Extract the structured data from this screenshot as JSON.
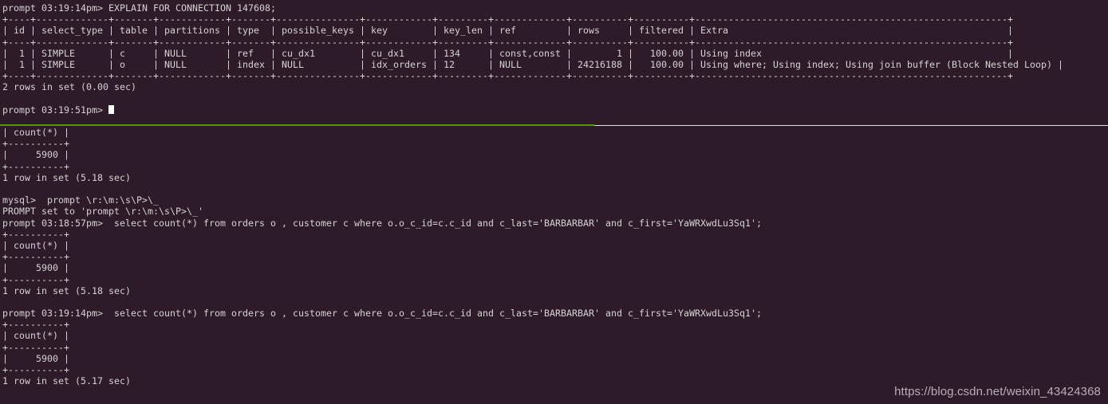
{
  "terminal": {
    "title": "MySQL client session",
    "colors": {
      "background": "#2d1b2a",
      "foreground": "#d8d2d4",
      "cursor": "#ffffff",
      "rule_left": "#4e9a06",
      "rule_right": "#e6e2e4",
      "watermark": "#b9aeb5"
    },
    "prompt_template": "prompt \\r:\\m:\\s\\P>\\_",
    "lines": [
      {
        "id": "l01",
        "text": "prompt 03:19:14pm> EXPLAIN FOR CONNECTION 147608;"
      },
      {
        "id": "l02",
        "text": "+----+-------------+-------+------------+-------+---------------+------------+---------+-------------+----------+----------+--------------------------------------------------------+"
      },
      {
        "id": "l03",
        "text": "| id | select_type | table | partitions | type  | possible_keys | key        | key_len | ref         | rows     | filtered | Extra                                                  |"
      },
      {
        "id": "l04",
        "text": "+----+-------------+-------+------------+-------+---------------+------------+---------+-------------+----------+----------+--------------------------------------------------------+"
      },
      {
        "id": "l05",
        "text": "|  1 | SIMPLE      | c     | NULL       | ref   | cu_dx1        | cu_dx1     | 134     | const,const |        1 |   100.00 | Using index                                            |"
      },
      {
        "id": "l06",
        "text": "|  1 | SIMPLE      | o     | NULL       | index | NULL          | idx_orders | 12      | NULL        | 24216188 |   100.00 | Using where; Using index; Using join buffer (Block Nested Loop) |"
      },
      {
        "id": "l07",
        "text": "+----+-------------+-------+------------+-------+---------------+------------+---------+-------------+----------+----------+--------------------------------------------------------+"
      },
      {
        "id": "l08",
        "text": "2 rows in set (0.00 sec)"
      },
      {
        "id": "l09",
        "text": ""
      },
      {
        "id": "l10",
        "text": "prompt 03:19:51pm> ",
        "cursor": true
      },
      {
        "id": "l11",
        "text": ""
      },
      {
        "id": "l12",
        "text": "| count(*) |"
      },
      {
        "id": "l13",
        "text": "+----------+"
      },
      {
        "id": "l14",
        "text": "|     5900 |"
      },
      {
        "id": "l15",
        "text": "+----------+"
      },
      {
        "id": "l16",
        "text": "1 row in set (5.18 sec)"
      },
      {
        "id": "l17",
        "text": ""
      },
      {
        "id": "l18",
        "text": "mysql>  prompt \\r:\\m:\\s\\P>\\_"
      },
      {
        "id": "l19",
        "text": "PROMPT set to 'prompt \\r:\\m:\\s\\P>\\_'"
      },
      {
        "id": "l20",
        "text": "prompt 03:18:57pm>  select count(*) from orders o , customer c where o.o_c_id=c.c_id and c_last='BARBARBAR' and c_first='YaWRXwdLu3Sq1';"
      },
      {
        "id": "l21",
        "text": "+----------+"
      },
      {
        "id": "l22",
        "text": "| count(*) |"
      },
      {
        "id": "l23",
        "text": "+----------+"
      },
      {
        "id": "l24",
        "text": "|     5900 |"
      },
      {
        "id": "l25",
        "text": "+----------+"
      },
      {
        "id": "l26",
        "text": "1 row in set (5.18 sec)"
      },
      {
        "id": "l27",
        "text": ""
      },
      {
        "id": "l28",
        "text": "prompt 03:19:14pm>  select count(*) from orders o , customer c where o.o_c_id=c.c_id and c_last='BARBARBAR' and c_first='YaWRXwdLu3Sq1';"
      },
      {
        "id": "l29",
        "text": "+----------+"
      },
      {
        "id": "l30",
        "text": "| count(*) |"
      },
      {
        "id": "l31",
        "text": "+----------+"
      },
      {
        "id": "l32",
        "text": "|     5900 |"
      },
      {
        "id": "l33",
        "text": "+----------+"
      },
      {
        "id": "l34",
        "text": "1 row in set (5.17 sec)"
      }
    ],
    "explain_table": {
      "headers": [
        "id",
        "select_type",
        "table",
        "partitions",
        "type",
        "possible_keys",
        "key",
        "key_len",
        "ref",
        "rows",
        "filtered",
        "Extra"
      ],
      "rows": [
        [
          "1",
          "SIMPLE",
          "c",
          "NULL",
          "ref",
          "cu_dx1",
          "cu_dx1",
          "134",
          "const,const",
          "1",
          "100.00",
          "Using index"
        ],
        [
          "1",
          "SIMPLE",
          "o",
          "NULL",
          "index",
          "NULL",
          "idx_orders",
          "12",
          "NULL",
          "24216188",
          "100.00",
          "Using where; Using index; Using join buffer (Block Nested Loop)"
        ]
      ],
      "footer": "2 rows in set (0.00 sec)"
    },
    "count_results": [
      {
        "header": "count(*)",
        "value": "5900",
        "footer": "1 row in set (5.18 sec)"
      },
      {
        "header": "count(*)",
        "value": "5900",
        "footer": "1 row in set (5.18 sec)"
      },
      {
        "header": "count(*)",
        "value": "5900",
        "footer": "1 row in set (5.17 sec)"
      }
    ],
    "commands": [
      "EXPLAIN FOR CONNECTION 147608;",
      "prompt \\r:\\m:\\s\\P>\\_",
      "select count(*) from orders o , customer c where o.o_c_id=c.c_id and c_last='BARBARBAR' and c_first='YaWRXwdLu3Sq1';",
      "select count(*) from orders o , customer c where o.o_c_id=c.c_id and c_last='BARBARBAR' and c_first='YaWRXwdLu3Sq1';"
    ],
    "watermark": "https://blog.csdn.net/weixin_43424368"
  }
}
